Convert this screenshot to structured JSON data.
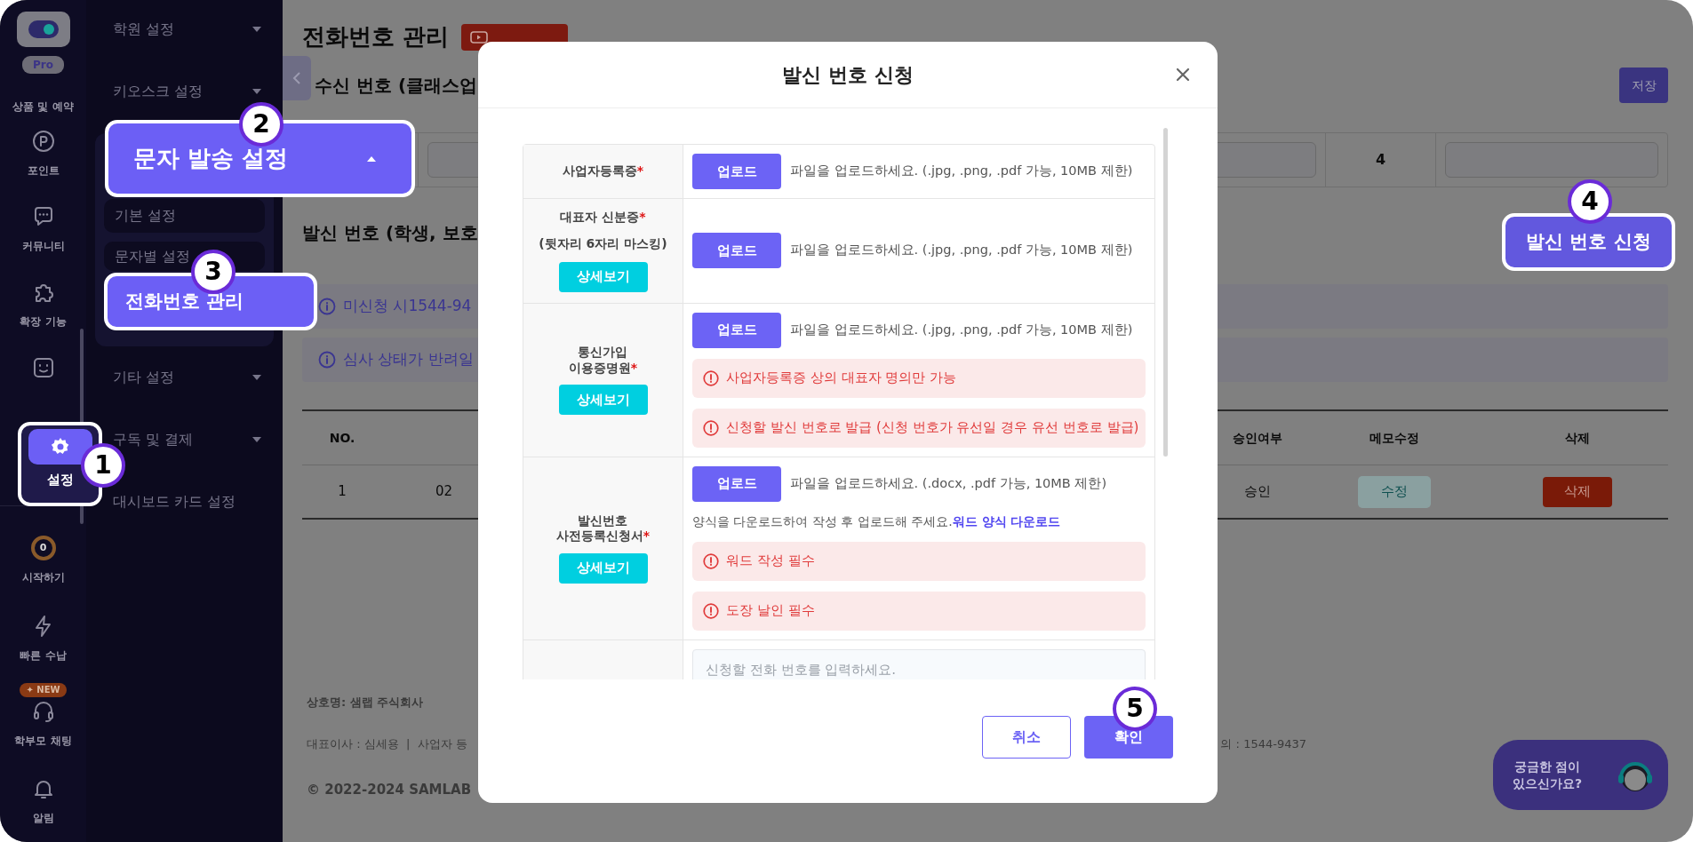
{
  "rail": {
    "logo_badge": "Pro",
    "items": [
      {
        "label": "상품 및 예약"
      },
      {
        "label": "포인트"
      },
      {
        "label": "커뮤니티"
      },
      {
        "label": "확장 기능"
      }
    ],
    "settings": {
      "label": "설정",
      "selected": true,
      "step": "1"
    },
    "bottom_items": [
      {
        "label": "시작하기",
        "count": "0"
      },
      {
        "label": "빠른 수납"
      },
      {
        "label": "학부모 채팅",
        "badge": "✦ NEW"
      },
      {
        "label": "알림"
      }
    ]
  },
  "menu": [
    {
      "label": "학원 설정",
      "kind": "group",
      "expanded": false
    },
    {
      "label": "키오스크 설정",
      "kind": "group",
      "expanded": false
    },
    {
      "label": "문자 발송 설정",
      "kind": "group",
      "expanded": true,
      "step": "2",
      "children": [
        {
          "label": "기본 설정",
          "selected": false
        },
        {
          "label": "문자별 설정",
          "selected": false
        },
        {
          "label": "전화번호 관리",
          "selected": true,
          "step": "3"
        }
      ]
    },
    {
      "label": "기타 설정",
      "kind": "group",
      "expanded": false
    },
    {
      "label": "구독 및 결제",
      "kind": "group",
      "expanded": false
    },
    {
      "label": "대시보드 카드 설정",
      "kind": "link"
    }
  ],
  "page": {
    "title": "전화번호 관리",
    "receive": {
      "heading": "수신 번호 (클래스업",
      "save_button": "저장",
      "cell_3": "4"
    },
    "send": {
      "heading": "발신 번호 (학생, 보호",
      "apply_button": {
        "label": "발신 번호 신청",
        "step": "4"
      },
      "notices": [
        "미신청 시1544-94",
        "심사 상태가 반려일"
      ],
      "table": {
        "columns": [
          "NO.",
          "승인여부",
          "메모수정",
          "삭제"
        ],
        "rows": [
          {
            "no": "1",
            "column_2": "02",
            "approval": "승인",
            "edit_button": "수정",
            "delete_button": "삭제"
          }
        ]
      }
    },
    "footer": {
      "company": "상호명: 샘랩 주식회사",
      "info_left": "대표이사 : 심세용  |  사업자 등",
      "info_right": "의 : 1544-9437",
      "copyright": "© 2022-2024 SAMLAB"
    },
    "chat_widget": "궁금한 점이\n있으신가요?"
  },
  "modal": {
    "title": "발신 번호 신청",
    "rows": [
      {
        "label": "사업자등록증",
        "required_mark": "*",
        "upload": "업로드",
        "hint": "파일을 업로드하세요. (.jpg, .png, .pdf 가능, 10MB 제한)"
      },
      {
        "label": "대표자 신분증",
        "required_mark": "*",
        "note": "(뒷자리 6자리 마스킹)",
        "detail_button": "상세보기",
        "upload": "업로드",
        "hint": "파일을 업로드하세요. (.jpg, .png, .pdf 가능, 10MB 제한)"
      },
      {
        "label": "통신가입\n이용증명원",
        "required_mark": "*",
        "detail_button": "상세보기",
        "upload": "업로드",
        "hint": "파일을 업로드하세요. (.jpg, .png, .pdf 가능, 10MB 제한)",
        "alerts": [
          "사업자등록증 상의 대표자 명의만 가능",
          "신청할 발신 번호로 발급 (신청 번호가 유선일 경우 유선 번호로 발급)"
        ]
      },
      {
        "label": "발신번호\n사전등록신청서",
        "required_mark": "*",
        "detail_button": "상세보기",
        "upload": "업로드",
        "hint": "파일을 업로드하세요. (.docx, .pdf 가능, 10MB 제한)",
        "instruction": "양식을 다운로드하여 작성 후 업로드해 주세요.",
        "download_link": "워드 양식 다운로드",
        "alerts": [
          "워드 작성 필수",
          "도장 날인 필수"
        ]
      },
      {
        "input_placeholder": "신청할 전화 번호를 입력하세요."
      }
    ],
    "cancel": "취소",
    "confirm": {
      "label": "확인",
      "step": "5"
    }
  }
}
